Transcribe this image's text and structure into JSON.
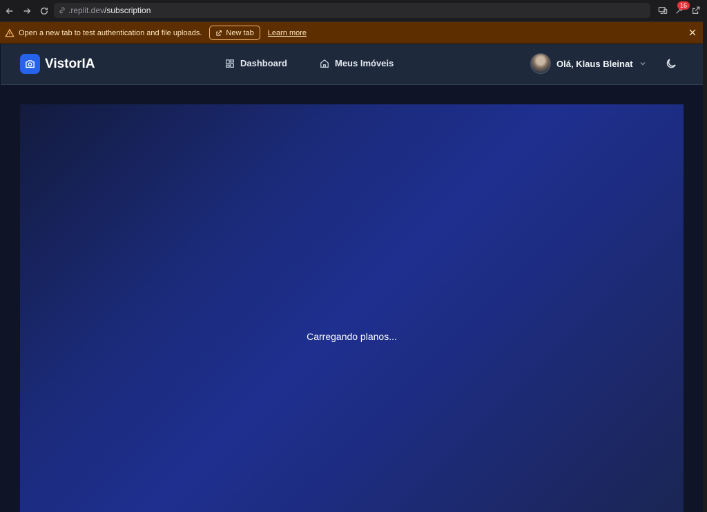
{
  "browser": {
    "url_host": ".replit.dev",
    "url_path": "/subscription",
    "notification_count": "16"
  },
  "banner": {
    "message": "Open a new tab to test authentication and file uploads.",
    "new_tab_label": "New tab",
    "learn_more_label": "Learn more"
  },
  "header": {
    "brand": "VistorIA",
    "nav": [
      {
        "label": "Dashboard",
        "icon": "grid-icon"
      },
      {
        "label": "Meus Imóveis",
        "icon": "home-icon"
      }
    ],
    "user_greeting": "Olá, Klaus Bleinat"
  },
  "main": {
    "loading_text": "Carregando planos..."
  },
  "colors": {
    "accent": "#2563eb",
    "banner_bg": "#5c2e00",
    "header_bg": "#1e293b",
    "page_bg": "#0f1426"
  }
}
